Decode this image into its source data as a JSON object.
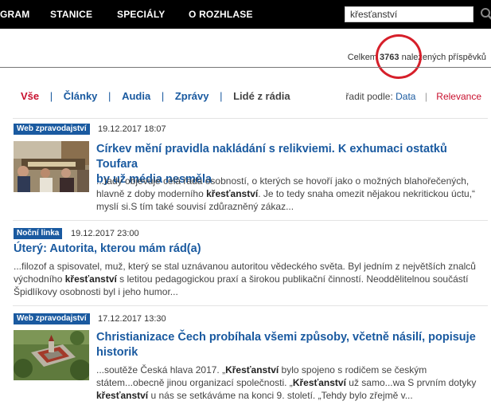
{
  "nav": {
    "items": [
      "GRAM",
      "STANICE",
      "SPECIÁLY",
      "O ROZHLASE"
    ],
    "search_value": "křesťanství"
  },
  "results": {
    "total_prefix": "Celkem",
    "total_count": "3763",
    "total_suffix": "nalezených příspěvků"
  },
  "filters": {
    "all": "Vše",
    "articles": "Články",
    "audio": "Audia",
    "news": "Zprávy",
    "people": "Lidé z rádia",
    "sort_label": "řadit podle:",
    "sort_date": "Data",
    "sort_relevance": "Relevance"
  },
  "articles": [
    {
      "badge": "Web zpravodajství",
      "date": "19.12.2017 18:07",
      "title_line1": "Církev mění pravidla nakládání s relikviemi. K exhumaci ostatků Toufara",
      "title_line2": "by už média nesměla",
      "ex1": "...tady objevuje celá řada osobností, o kterých se hovoří jako o možných blahořečených,",
      "ex2_a": "hlavně z doby moderního ",
      "ex2_b": "křesťanství",
      "ex2_c": ". Je to tedy snaha omezit nějakou nekritickou úctu,“",
      "ex3": "myslí si.S tím také souvisí zdůrazněný zákaz..."
    },
    {
      "badge": "Noční linka",
      "date": "19.12.2017 23:00",
      "title": "Úterý: Autorita, kterou mám rád(a)",
      "ex1": "...filozof a spisovatel, muž, který se stal uznávanou autoritou vědeckého světa. Byl jedním z největších znalců",
      "ex2_a": "východního ",
      "ex2_b": "křesťanství",
      "ex2_c": " s letitou pedagogickou praxí a širokou publikační činností. Neoddělitelnou součástí",
      "ex3": "Špidlíkovy osobnosti byl i jeho humor..."
    },
    {
      "badge": "Web zpravodajství",
      "date": "17.12.2017 13:30",
      "title_line1": "Christianizace Čech probíhala všemi způsoby, včetně násilí, popisuje",
      "title_line2": "historik",
      "ex1_a": "...soutěže Česká hlava 2017. „",
      "ex1_b": "Křesťanství",
      "ex1_c": " bylo spojeno s rodičem se českým",
      "ex2_a": "státem...obecně jinou organizací společnosti. „",
      "ex2_b": "Křesťanství",
      "ex2_c": " už samo...wa S prvním dotyky",
      "ex3_a": "křesťanství",
      "ex3_b": " u nás se setkáváme na konci 9. století. „Tehdy bylo zřejmě v..."
    }
  ]
}
